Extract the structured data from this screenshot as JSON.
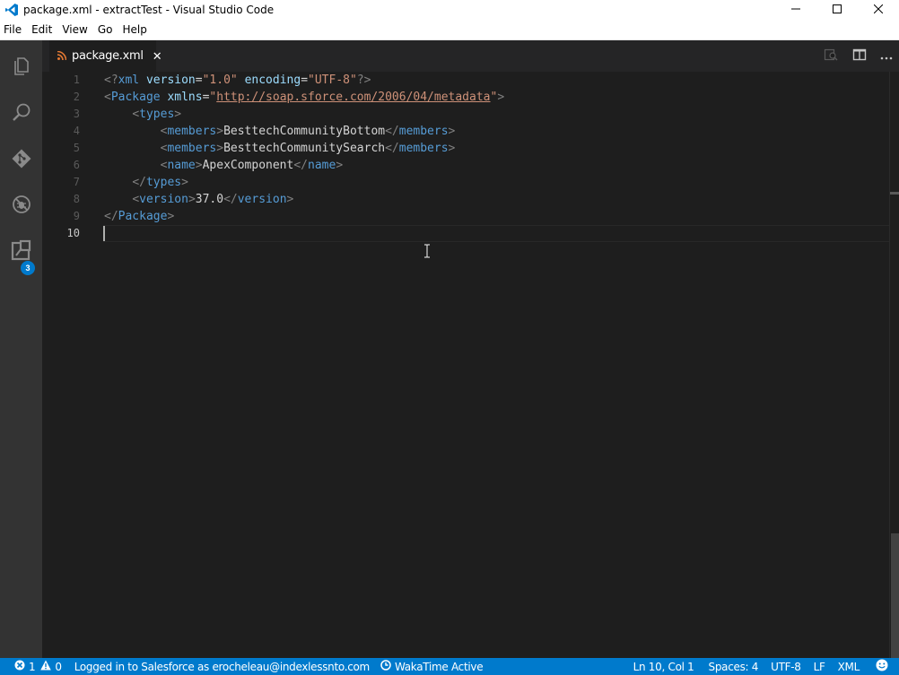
{
  "window": {
    "title": "package.xml - extractTest - Visual Studio Code"
  },
  "menu": {
    "items": [
      "File",
      "Edit",
      "View",
      "Go",
      "Help"
    ]
  },
  "activity": {
    "items": [
      "explorer-icon",
      "search-icon",
      "git-icon",
      "debug-icon",
      "extensions-icon"
    ],
    "extensions_badge": "3"
  },
  "tab": {
    "label": "package.xml",
    "close": "✕"
  },
  "editor": {
    "line_numbers": [
      "1",
      "2",
      "3",
      "4",
      "5",
      "6",
      "7",
      "8",
      "9",
      "10"
    ],
    "lines": [
      [
        {
          "c": "t-punc",
          "t": "<?"
        },
        {
          "c": "t-tag",
          "t": "xml"
        },
        {
          "c": "t-text",
          "t": " "
        },
        {
          "c": "t-attr",
          "t": "version"
        },
        {
          "c": "t-text",
          "t": "="
        },
        {
          "c": "t-str",
          "t": "\"1.0\""
        },
        {
          "c": "t-text",
          "t": " "
        },
        {
          "c": "t-attr",
          "t": "encoding"
        },
        {
          "c": "t-text",
          "t": "="
        },
        {
          "c": "t-str",
          "t": "\"UTF-8\""
        },
        {
          "c": "t-punc",
          "t": "?>"
        }
      ],
      [
        {
          "c": "t-punc",
          "t": "<"
        },
        {
          "c": "t-tag",
          "t": "Package"
        },
        {
          "c": "t-text",
          "t": " "
        },
        {
          "c": "t-attr",
          "t": "xmlns"
        },
        {
          "c": "t-text",
          "t": "="
        },
        {
          "c": "t-str",
          "t": "\""
        },
        {
          "c": "t-url",
          "t": "http://soap.sforce.com/2006/04/metadata"
        },
        {
          "c": "t-str",
          "t": "\""
        },
        {
          "c": "t-punc",
          "t": ">"
        }
      ],
      [
        {
          "c": "t-text",
          "t": "    "
        },
        {
          "c": "t-punc",
          "t": "<"
        },
        {
          "c": "t-tag",
          "t": "types"
        },
        {
          "c": "t-punc",
          "t": ">"
        }
      ],
      [
        {
          "c": "t-text",
          "t": "        "
        },
        {
          "c": "t-punc",
          "t": "<"
        },
        {
          "c": "t-tag",
          "t": "members"
        },
        {
          "c": "t-punc",
          "t": ">"
        },
        {
          "c": "t-text",
          "t": "BesttechCommunityBottom"
        },
        {
          "c": "t-punc",
          "t": "</"
        },
        {
          "c": "t-tag",
          "t": "members"
        },
        {
          "c": "t-punc",
          "t": ">"
        }
      ],
      [
        {
          "c": "t-text",
          "t": "        "
        },
        {
          "c": "t-punc",
          "t": "<"
        },
        {
          "c": "t-tag",
          "t": "members"
        },
        {
          "c": "t-punc",
          "t": ">"
        },
        {
          "c": "t-text",
          "t": "BesttechCommunitySearch"
        },
        {
          "c": "t-punc",
          "t": "</"
        },
        {
          "c": "t-tag",
          "t": "members"
        },
        {
          "c": "t-punc",
          "t": ">"
        }
      ],
      [
        {
          "c": "t-text",
          "t": "        "
        },
        {
          "c": "t-punc",
          "t": "<"
        },
        {
          "c": "t-tag",
          "t": "name"
        },
        {
          "c": "t-punc",
          "t": ">"
        },
        {
          "c": "t-text",
          "t": "ApexComponent"
        },
        {
          "c": "t-punc",
          "t": "</"
        },
        {
          "c": "t-tag",
          "t": "name"
        },
        {
          "c": "t-punc",
          "t": ">"
        }
      ],
      [
        {
          "c": "t-text",
          "t": "    "
        },
        {
          "c": "t-punc",
          "t": "</"
        },
        {
          "c": "t-tag",
          "t": "types"
        },
        {
          "c": "t-punc",
          "t": ">"
        }
      ],
      [
        {
          "c": "t-text",
          "t": "    "
        },
        {
          "c": "t-punc",
          "t": "<"
        },
        {
          "c": "t-tag",
          "t": "version"
        },
        {
          "c": "t-punc",
          "t": ">"
        },
        {
          "c": "t-text",
          "t": "37.0"
        },
        {
          "c": "t-punc",
          "t": "</"
        },
        {
          "c": "t-tag",
          "t": "version"
        },
        {
          "c": "t-punc",
          "t": ">"
        }
      ],
      [
        {
          "c": "t-punc",
          "t": "</"
        },
        {
          "c": "t-tag",
          "t": "Package"
        },
        {
          "c": "t-punc",
          "t": ">"
        }
      ],
      []
    ]
  },
  "status": {
    "errors": "1",
    "warnings": "0",
    "salesforce": "Logged in to Salesforce as erocheleau@indexlessnto.com",
    "wakatime": "WakaTime Active",
    "position": "Ln 10, Col 1",
    "spaces": "Spaces: 4",
    "encoding": "UTF-8",
    "eol": "LF",
    "language": "XML"
  },
  "colors": {
    "statusbar": "#007acc",
    "activitybar": "#333333",
    "editor_bg": "#1e1e1e",
    "tag": "#569cd6",
    "attr": "#9cdcfe",
    "string": "#ce9178"
  }
}
